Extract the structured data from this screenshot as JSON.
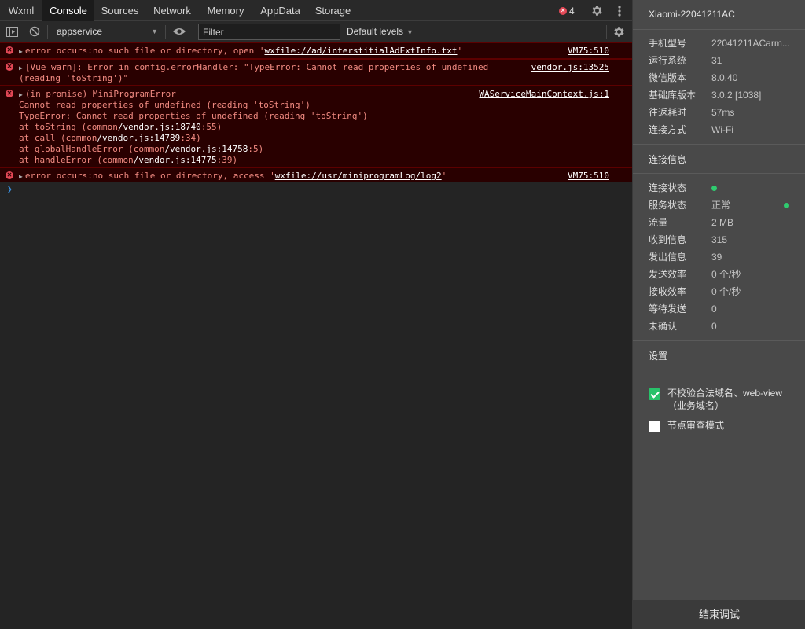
{
  "tabs": [
    "Wxml",
    "Console",
    "Sources",
    "Network",
    "Memory",
    "AppData",
    "Storage"
  ],
  "active_tab": "Console",
  "error_badge_count": "4",
  "toolbar": {
    "context": "appservice",
    "filter_placeholder": "Filter",
    "levels": "Default levels"
  },
  "messages": [
    {
      "lines": [
        {
          "parts": [
            {
              "t": "error occurs:no such file or directory, open '"
            },
            {
              "t": "wxfile://ad/interstitialAdExtInfo.txt",
              "link": true
            },
            {
              "t": "'"
            }
          ]
        }
      ],
      "source": "VM75:510",
      "expandable": true
    },
    {
      "lines": [
        {
          "parts": [
            {
              "t": "[Vue warn]: Error in config.errorHandler: \"TypeError: Cannot read properties of undefined"
            }
          ]
        },
        {
          "parts": [
            {
              "t": "(reading 'toString')\""
            }
          ]
        }
      ],
      "source": "vendor.js:13525",
      "expandable": true
    },
    {
      "lines": [
        {
          "parts": [
            {
              "t": "(in promise) MiniProgramError"
            }
          ]
        },
        {
          "parts": [
            {
              "t": "Cannot read properties of undefined (reading 'toString')"
            }
          ]
        },
        {
          "parts": [
            {
              "t": "TypeError: Cannot read properties of undefined (reading 'toString')"
            }
          ]
        },
        {
          "parts": [
            {
              "t": "at toString (common"
            },
            {
              "t": "/vendor.js:18740",
              "link": true
            },
            {
              "t": ":55)"
            }
          ]
        },
        {
          "parts": [
            {
              "t": "at call (common"
            },
            {
              "t": "/vendor.js:14789",
              "link": true
            },
            {
              "t": ":34)"
            }
          ]
        },
        {
          "parts": [
            {
              "t": "at globalHandleError (common"
            },
            {
              "t": "/vendor.js:14758",
              "link": true
            },
            {
              "t": ":5)"
            }
          ]
        },
        {
          "parts": [
            {
              "t": "at handleError (common"
            },
            {
              "t": "/vendor.js:14775",
              "link": true
            },
            {
              "t": ":39)"
            }
          ]
        }
      ],
      "source": "WAServiceMainContext.js:1",
      "expandable": true
    },
    {
      "lines": [
        {
          "parts": [
            {
              "t": "error occurs:no such file or directory, access '"
            },
            {
              "t": "wxfile://usr/miniprogramLog/log2",
              "link": true
            },
            {
              "t": "'"
            }
          ]
        }
      ],
      "source": "VM75:510",
      "expandable": true
    }
  ],
  "panel": {
    "device": "Xiaomi-22041211AC",
    "device_info": [
      {
        "k": "手机型号",
        "v": "22041211ACarm..."
      },
      {
        "k": "运行系统",
        "v": "31"
      },
      {
        "k": "微信版本",
        "v": "8.0.40"
      },
      {
        "k": "基础库版本",
        "v": "3.0.2 [1038]"
      },
      {
        "k": "往返耗时",
        "v": "57ms"
      },
      {
        "k": "连接方式",
        "v": "Wi-Fi"
      }
    ],
    "conn_title": "连接信息",
    "conn_info": [
      {
        "k": "连接状态",
        "v": "",
        "dot": true
      },
      {
        "k": "服务状态",
        "v": "正常",
        "dot_right": true
      },
      {
        "k": "流量",
        "v": "2 MB"
      },
      {
        "k": "收到信息",
        "v": "315"
      },
      {
        "k": "发出信息",
        "v": "39"
      },
      {
        "k": "发送效率",
        "v": "0 个/秒"
      },
      {
        "k": "接收效率",
        "v": "0 个/秒"
      },
      {
        "k": "等待发送",
        "v": "0"
      },
      {
        "k": "未确认",
        "v": "0"
      }
    ],
    "settings_title": "设置",
    "options": [
      {
        "label": "不校验合法域名、web-view（业务域名）",
        "checked": true
      },
      {
        "label": "节点审查模式",
        "checked": false
      }
    ],
    "end_button": "结束调试"
  },
  "colors": {
    "error_bg": "#290000",
    "error_text": "#f28b82",
    "status_green": "#2fcb6f",
    "checkbox_green": "#28c26a"
  }
}
